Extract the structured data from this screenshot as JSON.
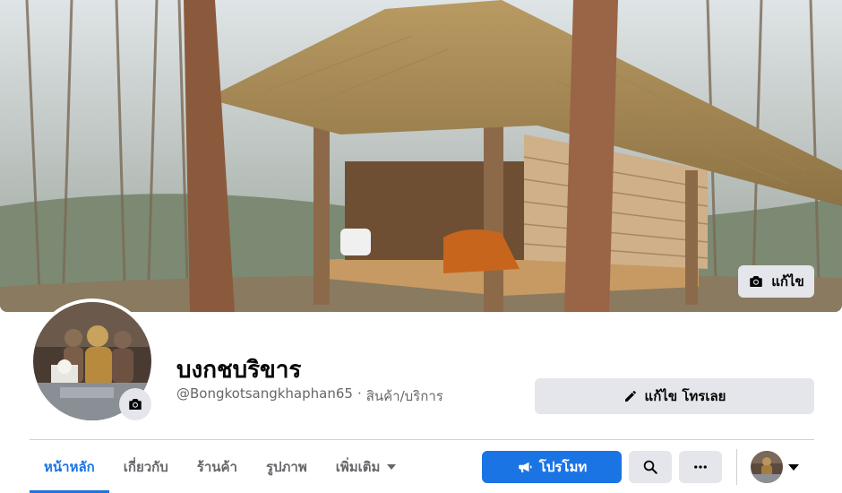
{
  "cover": {
    "edit_label": "แก้ไข"
  },
  "profile": {
    "name": "บงกชบริขาร",
    "handle": "@Bongkotsangkhaphan65",
    "separator": "·",
    "category": "สินค้า/บริการ"
  },
  "actions": {
    "edit_promote_label": "แก้ไข โทรเลย",
    "promote_label": "โปรโมท"
  },
  "tabs": [
    {
      "label": "หน้าหลัก",
      "active": true
    },
    {
      "label": "เกี่ยวกับ",
      "active": false
    },
    {
      "label": "ร้านค้า",
      "active": false
    },
    {
      "label": "รูปภาพ",
      "active": false
    },
    {
      "label": "เพิ่มเติม",
      "active": false,
      "has_dropdown": true
    }
  ],
  "icons": {
    "cover_edit": "camera-icon",
    "avatar_edit": "camera-icon",
    "edit_promote": "pencil-icon",
    "promote": "megaphone-icon",
    "search": "search-icon",
    "more": "more-dots-icon",
    "account_menu": "chevron-down-icon"
  },
  "colors": {
    "accent": "#1b74e4",
    "button_grey": "#e4e6eb",
    "secondary_text": "#65676b"
  }
}
